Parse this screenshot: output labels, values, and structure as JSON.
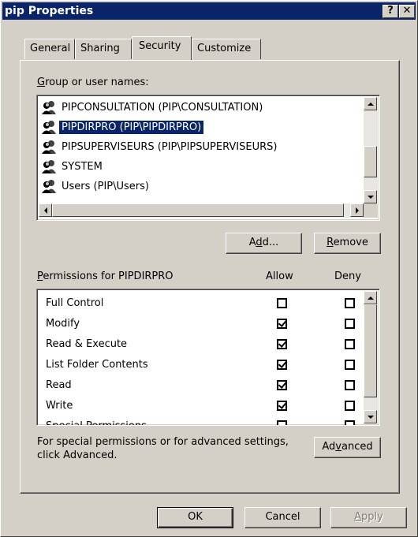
{
  "window": {
    "title": "pip Properties",
    "help_glyph": "?",
    "close_glyph": "✕"
  },
  "tabs": [
    {
      "label": "General"
    },
    {
      "label": "Sharing"
    },
    {
      "label": "Security",
      "active": true
    },
    {
      "label": "Customize"
    }
  ],
  "groups": {
    "label_mnemonic": "G",
    "label_rest": "roup or user names:",
    "items": [
      {
        "name": "PIPCONSULTATION (PIP\\CONSULTATION)",
        "selected": false
      },
      {
        "name": "PIPDIRPRO (PIP\\PIPDIRPRO)",
        "selected": true
      },
      {
        "name": "PIPSUPERVISEURS (PIP\\PIPSUPERVISEURS)",
        "selected": false
      },
      {
        "name": "SYSTEM",
        "selected": false
      },
      {
        "name": "Users (PIP\\Users)",
        "selected": false
      }
    ],
    "add_pre": "A",
    "add_mn": "d",
    "add_post": "d...",
    "remove_mn": "R",
    "remove_post": "emove"
  },
  "permissions": {
    "label_mn": "P",
    "label_rest": "ermissions for PIPDIRPRO",
    "allow_header": "Allow",
    "deny_header": "Deny",
    "rows": [
      {
        "name": "Full Control",
        "allow": false,
        "deny": false
      },
      {
        "name": "Modify",
        "allow": true,
        "deny": false
      },
      {
        "name": "Read & Execute",
        "allow": true,
        "deny": false
      },
      {
        "name": "List Folder Contents",
        "allow": true,
        "deny": false
      },
      {
        "name": "Read",
        "allow": true,
        "deny": false
      },
      {
        "name": "Write",
        "allow": true,
        "deny": false
      },
      {
        "name": "Special Permissions",
        "allow": false,
        "deny": false
      }
    ]
  },
  "advanced": {
    "note_line1": "For special permissions or for advanced settings,",
    "note_line2": "click Advanced.",
    "btn_pre": "Ad",
    "btn_mn": "v",
    "btn_post": "anced"
  },
  "footer": {
    "ok": "OK",
    "cancel": "Cancel",
    "apply_mn": "A",
    "apply_post": "pply"
  }
}
